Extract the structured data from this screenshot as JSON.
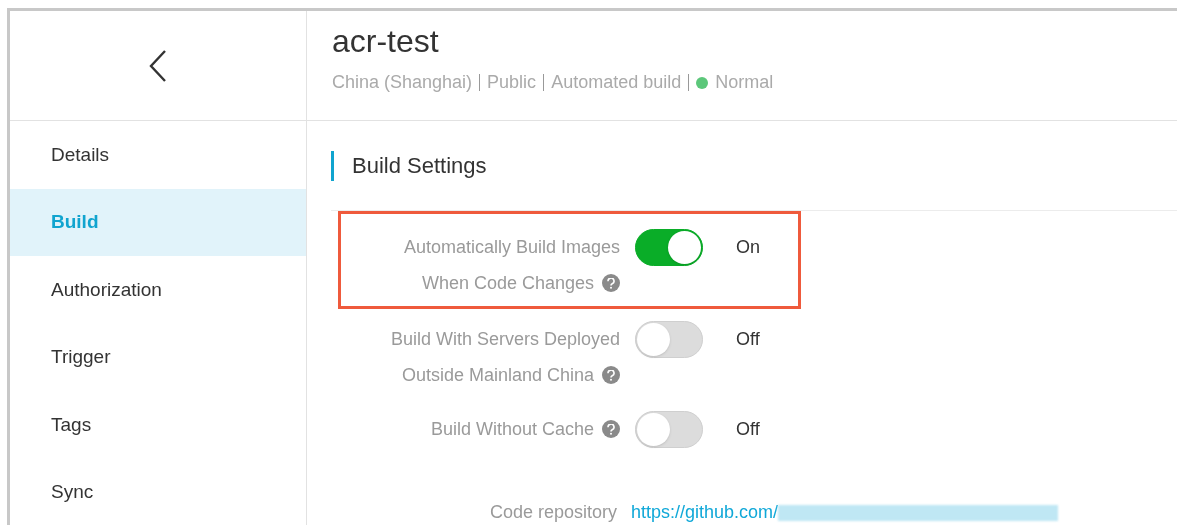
{
  "repository": {
    "name": "acr-test",
    "meta": [
      "China (Shanghai)",
      "Public",
      "Automated build"
    ],
    "status": {
      "label": "Normal",
      "color": "#5cc77a"
    }
  },
  "sidebar": {
    "items": [
      {
        "label": "Details",
        "selected": false
      },
      {
        "label": "Build",
        "selected": true
      },
      {
        "label": "Authorization",
        "selected": false
      },
      {
        "label": "Trigger",
        "selected": false
      },
      {
        "label": "Tags",
        "selected": false
      },
      {
        "label": "Sync",
        "selected": false
      }
    ]
  },
  "section": {
    "title": "Build Settings"
  },
  "settings": [
    {
      "label_lines": [
        "Automatically Build Images",
        "When Code Changes"
      ],
      "help": true,
      "on": true,
      "state_text": "On",
      "highlighted": true
    },
    {
      "label_lines": [
        "Build With Servers Deployed",
        "Outside Mainland China"
      ],
      "help": true,
      "on": false,
      "state_text": "Off",
      "highlighted": false
    },
    {
      "label_lines": [
        "Build Without Cache"
      ],
      "help": true,
      "on": false,
      "state_text": "Off",
      "highlighted": false
    }
  ],
  "code_repository": {
    "label": "Code repository",
    "url": "https://github.com/",
    "redacted": true
  }
}
